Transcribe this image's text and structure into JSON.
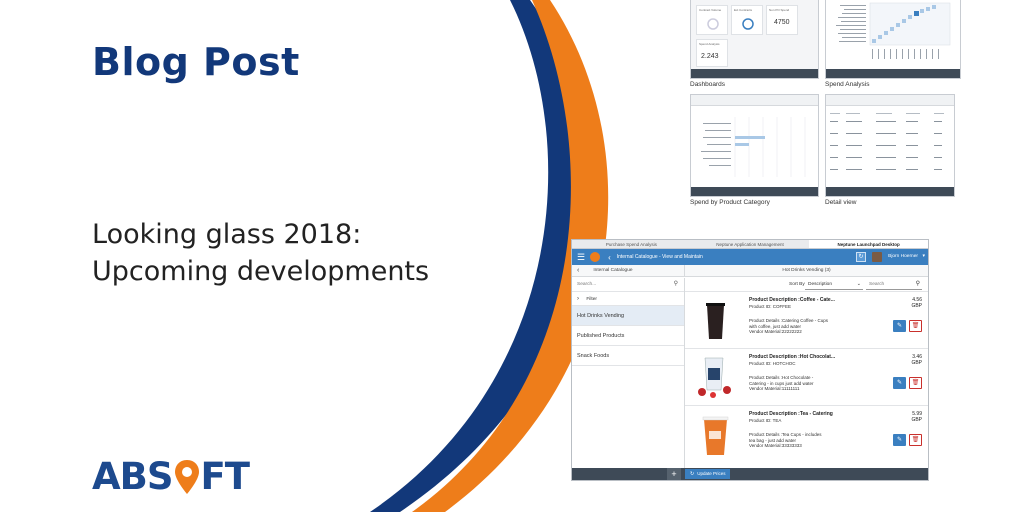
{
  "blog_title": "Blog Post",
  "headline_line1": "Looking glass 2018:",
  "headline_line2": "Upcoming developments",
  "logo": {
    "text_left": "ABS",
    "text_right": "FT"
  },
  "colors": {
    "navy": "#12387a",
    "orange": "#ee7d1a",
    "shell_blue": "#3a7fc0"
  },
  "thumbnails": [
    {
      "caption": "Dashboards"
    },
    {
      "caption": "Spend Analysis"
    },
    {
      "caption": "Spend by Product Category"
    },
    {
      "caption": "Detail view"
    }
  ],
  "dash_kpi": {
    "value1": "4750",
    "value2": "2.243"
  },
  "app": {
    "browser_tabs": [
      "Purchase Spend Analysis",
      "Neptune Application Management",
      "Neptune Launchpad Desktop"
    ],
    "shell_title": "Internal Catalogue - View and Maintain",
    "user_name": "Bjorn Hoerner",
    "master_title": "Internal Catalogue",
    "detail_title": "Hot Drinks Vending (3)",
    "search_placeholder": "Search...",
    "filter_label": "Filter",
    "sort_label": "Sort By",
    "sort_value": "Description",
    "detail_search_placeholder": "Search",
    "categories": [
      "Hot Drinks Vending",
      "Published Products",
      "Snack Foods"
    ],
    "products": [
      {
        "title": "Product Description :Coffee - Cate...",
        "id": "Product ID: COFFEE",
        "details1": "Product Details :Catering Coffee - Cups",
        "details2": "with coffee, just add water",
        "vendor": "Vendor Material:22222222",
        "price": "4.56",
        "currency": "GBP"
      },
      {
        "title": "Product Description :Hot Chocolat...",
        "id": "Product ID: HOTCHOC",
        "details1": "Product Details :Hot Chocolate -",
        "details2": "Catering - in cups just add water",
        "vendor": "Vendor Material:11111111",
        "price": "3.46",
        "currency": "GBP"
      },
      {
        "title": "Product Description :Tea - Catering",
        "id": "Product ID: TEA",
        "details1": "Product Details :Tea Cups - includes",
        "details2": "tea bag - just add water",
        "vendor": "Vendor Material:33333333",
        "price": "5.99",
        "currency": "GBP"
      }
    ],
    "footer_button": "Update Prices"
  }
}
